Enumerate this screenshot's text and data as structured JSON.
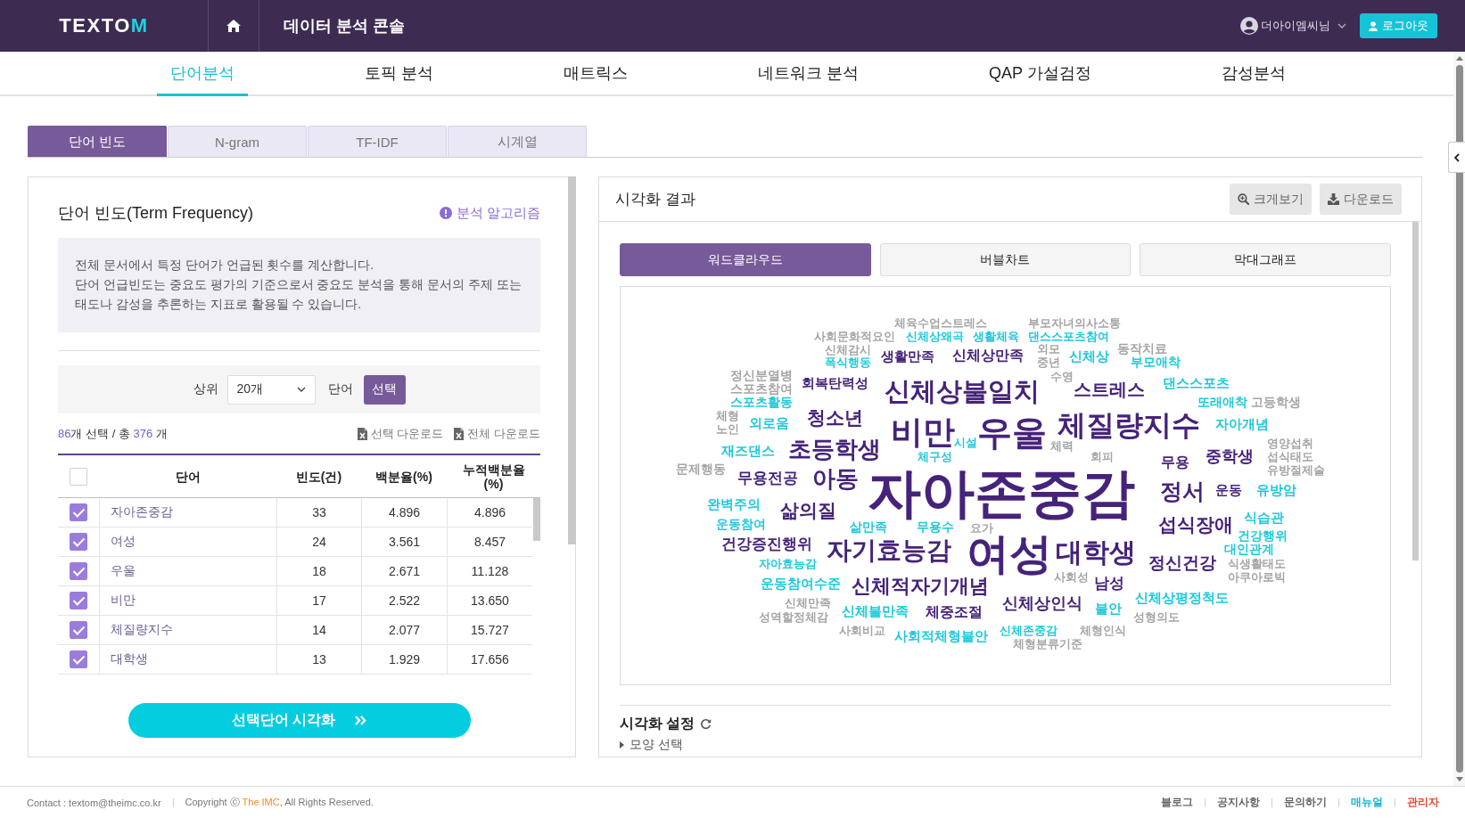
{
  "header": {
    "logo": {
      "text": "TEXTO",
      "accent": "M"
    },
    "title": "데이터 분석 콘솔",
    "user_name": "더아이엠씨님",
    "logout_button": "로그아웃"
  },
  "nav_tabs": [
    {
      "label": "단어분석",
      "selected": true
    },
    {
      "label": "토픽 분석",
      "selected": false
    },
    {
      "label": "매트릭스",
      "selected": false
    },
    {
      "label": "네트워크 분석",
      "selected": false
    },
    {
      "label": "QAP 가설검정",
      "selected": false
    },
    {
      "label": "감성분석",
      "selected": false
    }
  ],
  "sub_tabs": [
    {
      "label": "단어 빈도",
      "selected": true
    },
    {
      "label": "N-gram",
      "selected": false
    },
    {
      "label": "TF-IDF",
      "selected": false
    },
    {
      "label": "시계열",
      "selected": false
    }
  ],
  "term_panel": {
    "title": "단어 빈도(Term Frequency)",
    "algorithm_link": "분석 알고리즘",
    "description": [
      "전체 문서에서 특정 단어가 언급된 횟수를 계산합니다.",
      "단어 언급빈도는 중요도 평가의 기준으로서 중요도 분석을 통해 문서의 주제 또는 태도나 감성을 추론하는 지표로 활용될 수 있습니다."
    ],
    "filter": {
      "top_label": "상위",
      "top_value": "20개",
      "word_label": "단어",
      "select_button": "선택"
    },
    "summary": {
      "selected": "86",
      "selected_text": "개 선택 / 총",
      "total": "376",
      "total_text": "개"
    },
    "downloads": [
      "선택 다운로드",
      "전체 다운로드"
    ],
    "table": {
      "all_checked": false,
      "columns": [
        "단어",
        "빈도(건)",
        "백분율(%)",
        "누적백분율(%)"
      ],
      "rows": [
        {
          "checked": true,
          "word": "자아존중감",
          "frequency": "33",
          "percent": "4.896",
          "cumulative": "4.896"
        },
        {
          "checked": true,
          "word": "여성",
          "frequency": "24",
          "percent": "3.561",
          "cumulative": "8.457"
        },
        {
          "checked": true,
          "word": "우울",
          "frequency": "18",
          "percent": "2.671",
          "cumulative": "11.128"
        },
        {
          "checked": true,
          "word": "비만",
          "frequency": "17",
          "percent": "2.522",
          "cumulative": "13.650"
        },
        {
          "checked": true,
          "word": "체질량지수",
          "frequency": "14",
          "percent": "2.077",
          "cumulative": "15.727"
        },
        {
          "checked": true,
          "word": "대학생",
          "frequency": "13",
          "percent": "1.929",
          "cumulative": "17.656"
        }
      ]
    },
    "visualize_button": "선택단어 시각화"
  },
  "result_panel": {
    "title": "시각화 결과",
    "buttons": [
      {
        "kind": "zoom",
        "label": "크게보기"
      },
      {
        "kind": "download",
        "label": "다운로드"
      }
    ],
    "tabs": [
      {
        "label": "워드클라우드",
        "selected": true
      },
      {
        "label": "버블차트",
        "selected": false
      },
      {
        "label": "막대그래프",
        "selected": false
      }
    ],
    "cloud": {
      "words": [
        {
          "text": "체육수업스트레스",
          "color": "#a5a5a5"
        },
        {
          "text": "부모자녀의사소통",
          "color": "#a5a5a5"
        },
        {
          "text": "사회문화적요인",
          "color": "#a5a5a5"
        },
        {
          "text": "신체상왜곡",
          "color": "#1ec9d9"
        },
        {
          "text": "생활체육",
          "color": "#1ec9d9"
        },
        {
          "text": "댄스스포츠참여",
          "color": "#1ec9d9"
        },
        {
          "text": "신체감시",
          "color": "#a5a5a5"
        },
        {
          "text": "생활만족",
          "color": "#46237a"
        },
        {
          "text": "신체상만족",
          "color": "#46237a"
        },
        {
          "text": "외모",
          "color": "#a5a5a5"
        },
        {
          "text": "신체상",
          "color": "#1ec9d9"
        },
        {
          "text": "동작치료",
          "color": "#a5a5a5"
        },
        {
          "text": "폭식행동",
          "color": "#1ec9d9"
        },
        {
          "text": "중년",
          "color": "#a5a5a5"
        },
        {
          "text": "부모애착",
          "color": "#1ec9d9"
        },
        {
          "text": "정신분열병",
          "color": "#a5a5a5"
        },
        {
          "text": "스포츠참여",
          "color": "#a5a5a5"
        },
        {
          "text": "회복탄력성",
          "color": "#46237a"
        },
        {
          "text": "신체상불일치",
          "color": "#46237a"
        },
        {
          "text": "수영",
          "color": "#a5a5a5"
        },
        {
          "text": "스트레스",
          "color": "#46237a"
        },
        {
          "text": "댄스스포츠",
          "color": "#1ec9d9"
        },
        {
          "text": "스포츠활동",
          "color": "#1ec9d9"
        },
        {
          "text": "또래애착",
          "color": "#1ec9d9"
        },
        {
          "text": "고등학생",
          "color": "#a5a5a5"
        },
        {
          "text": "체형",
          "color": "#a5a5a5"
        },
        {
          "text": "노인",
          "color": "#a5a5a5"
        },
        {
          "text": "외로움",
          "color": "#1ec9d9"
        },
        {
          "text": "청소년",
          "color": "#46237a"
        },
        {
          "text": "비만",
          "color": "#46237a"
        },
        {
          "text": "우울",
          "color": "#46237a"
        },
        {
          "text": "체질량지수",
          "color": "#46237a"
        },
        {
          "text": "자아개념",
          "color": "#1ec9d9"
        },
        {
          "text": "재즈댄스",
          "color": "#1ec9d9"
        },
        {
          "text": "문제행동",
          "color": "#a5a5a5"
        },
        {
          "text": "초등학생",
          "color": "#46237a"
        },
        {
          "text": "체구성",
          "color": "#1ec9d9"
        },
        {
          "text": "시설",
          "color": "#1ec9d9"
        },
        {
          "text": "체력",
          "color": "#a5a5a5"
        },
        {
          "text": "회피",
          "color": "#a5a5a5"
        },
        {
          "text": "무용",
          "color": "#46237a"
        },
        {
          "text": "중학생",
          "color": "#46237a"
        },
        {
          "text": "영양섭취",
          "color": "#a5a5a5"
        },
        {
          "text": "섭식태도",
          "color": "#a5a5a5"
        },
        {
          "text": "유방절제술",
          "color": "#a5a5a5"
        },
        {
          "text": "무용전공",
          "color": "#46237a"
        },
        {
          "text": "아동",
          "color": "#46237a"
        },
        {
          "text": "자아존중감",
          "color": "#46237a"
        },
        {
          "text": "정서",
          "color": "#46237a"
        },
        {
          "text": "운동",
          "color": "#46237a"
        },
        {
          "text": "유방암",
          "color": "#1ec9d9"
        },
        {
          "text": "완벽주의",
          "color": "#1ec9d9"
        },
        {
          "text": "삶의질",
          "color": "#46237a"
        },
        {
          "text": "운동참여",
          "color": "#1ec9d9"
        },
        {
          "text": "삶만족",
          "color": "#1ec9d9"
        },
        {
          "text": "무용수",
          "color": "#1ec9d9"
        },
        {
          "text": "요가",
          "color": "#a5a5a5"
        },
        {
          "text": "섭식장애",
          "color": "#46237a"
        },
        {
          "text": "식습관",
          "color": "#1ec9d9"
        },
        {
          "text": "건강증진행위",
          "color": "#46237a"
        },
        {
          "text": "자기효능감",
          "color": "#46237a"
        },
        {
          "text": "여성",
          "color": "#46237a"
        },
        {
          "text": "대학생",
          "color": "#46237a"
        },
        {
          "text": "건강행위",
          "color": "#1ec9d9"
        },
        {
          "text": "대인관계",
          "color": "#1ec9d9"
        },
        {
          "text": "자아효능감",
          "color": "#1ec9d9"
        },
        {
          "text": "정신건강",
          "color": "#46237a"
        },
        {
          "text": "식생활태도",
          "color": "#a5a5a5"
        },
        {
          "text": "운동참여수준",
          "color": "#1ec9d9"
        },
        {
          "text": "신체적자기개념",
          "color": "#46237a"
        },
        {
          "text": "사회성",
          "color": "#a5a5a5"
        },
        {
          "text": "남성",
          "color": "#46237a"
        },
        {
          "text": "아쿠아로빅",
          "color": "#a5a5a5"
        },
        {
          "text": "신체만족",
          "color": "#a5a5a5"
        },
        {
          "text": "성역할정체감",
          "color": "#a5a5a5"
        },
        {
          "text": "신체불만족",
          "color": "#1ec9d9"
        },
        {
          "text": "체중조절",
          "color": "#46237a"
        },
        {
          "text": "신체상인식",
          "color": "#46237a"
        },
        {
          "text": "불안",
          "color": "#1ec9d9"
        },
        {
          "text": "신체상평정척도",
          "color": "#1ec9d9"
        },
        {
          "text": "성형의도",
          "color": "#a5a5a5"
        },
        {
          "text": "사회비교",
          "color": "#a5a5a5"
        },
        {
          "text": "사회적체형불안",
          "color": "#1ec9d9"
        },
        {
          "text": "신체존중감",
          "color": "#1ec9d9"
        },
        {
          "text": "체형인식",
          "color": "#a5a5a5"
        },
        {
          "text": "체형분류기준",
          "color": "#a5a5a5"
        }
      ]
    },
    "settings": {
      "title": "시각화 설정",
      "section": {
        "label": "모양 선택",
        "expanded": false
      }
    }
  },
  "footer": {
    "contact": "Contact : textom@theimc.co.kr",
    "copyright": {
      "prefix": "Copyright ⓒ",
      "company": "The IMC",
      "suffix": ", All Rights Reserved."
    },
    "links": [
      {
        "label": "블로그",
        "color": "#555555"
      },
      {
        "label": "공지사항",
        "color": "#555555"
      },
      {
        "label": "문의하기",
        "color": "#555555"
      },
      {
        "label": "매뉴얼",
        "color": "#14b8cc"
      },
      {
        "label": "관리자",
        "color": "#e8452c"
      }
    ]
  }
}
